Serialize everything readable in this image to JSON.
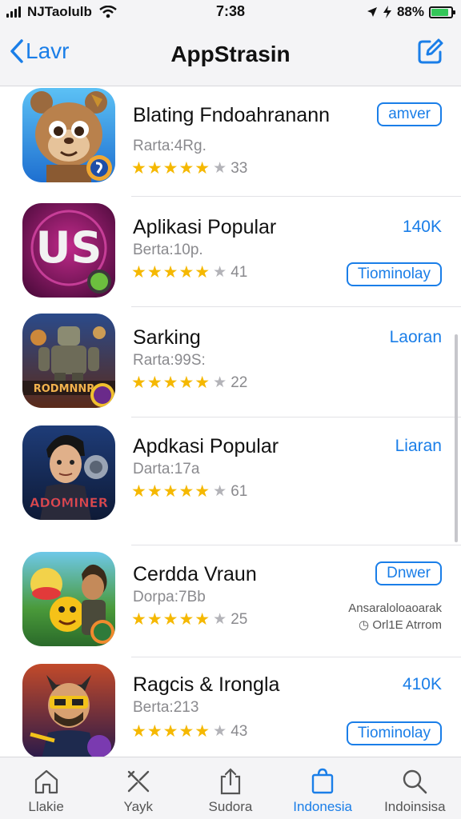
{
  "status_bar": {
    "carrier": "NJTaolulb",
    "time": "7:38",
    "battery": "88%",
    "battery_level": 0.88
  },
  "nav": {
    "back_label": "Lavr",
    "title": "AppStrasin"
  },
  "apps": [
    {
      "name": "Blating Fndoahranann",
      "subtitle": "Rarta:4Rg.",
      "rating_count": "33",
      "stars_filled": 5,
      "action": "amver",
      "action_style": "outline"
    },
    {
      "name": "Aplikasi Popular",
      "subtitle": "Berta:10p.",
      "rating_count": "41",
      "stars_filled": 5,
      "action": "140K",
      "action_style": "text",
      "secondary_action": "Tiominolay"
    },
    {
      "name": "Sarking",
      "subtitle": "Rarta:99S:",
      "rating_count": "22",
      "stars_filled": 5,
      "action": "Laoran",
      "action_style": "text"
    },
    {
      "name": "Apdkasi Popular",
      "subtitle": "Darta:17a",
      "rating_count": "61",
      "stars_filled": 5,
      "action": "Liaran",
      "action_style": "text"
    },
    {
      "name": "Cerdda Vraun",
      "subtitle": "Dorpa:7Bb",
      "rating_count": "25",
      "stars_filled": 5,
      "action": "Dnwer",
      "action_style": "outline",
      "info_line1": "Ansaraloloaoarak",
      "info_line2": "Orl1E Atrrom"
    },
    {
      "name": "Ragcis & Irongla",
      "subtitle": "Berta:213",
      "rating_count": "43",
      "stars_filled": 5,
      "action": "410K",
      "action_style": "text",
      "secondary_action": "Tiominolay"
    }
  ],
  "tabs": [
    {
      "label": "Llakie",
      "icon": "home-icon"
    },
    {
      "label": "Yayk",
      "icon": "tools-icon"
    },
    {
      "label": "Sudora",
      "icon": "share-icon"
    },
    {
      "label": "Indonesia",
      "icon": "bag-icon",
      "active": true
    },
    {
      "label": "Indoinsisa",
      "icon": "search-icon"
    }
  ],
  "colors": {
    "accent": "#1a7ee8",
    "star": "#f5b800",
    "bar_bg": "#f4f4f6",
    "battery": "#34c759"
  }
}
